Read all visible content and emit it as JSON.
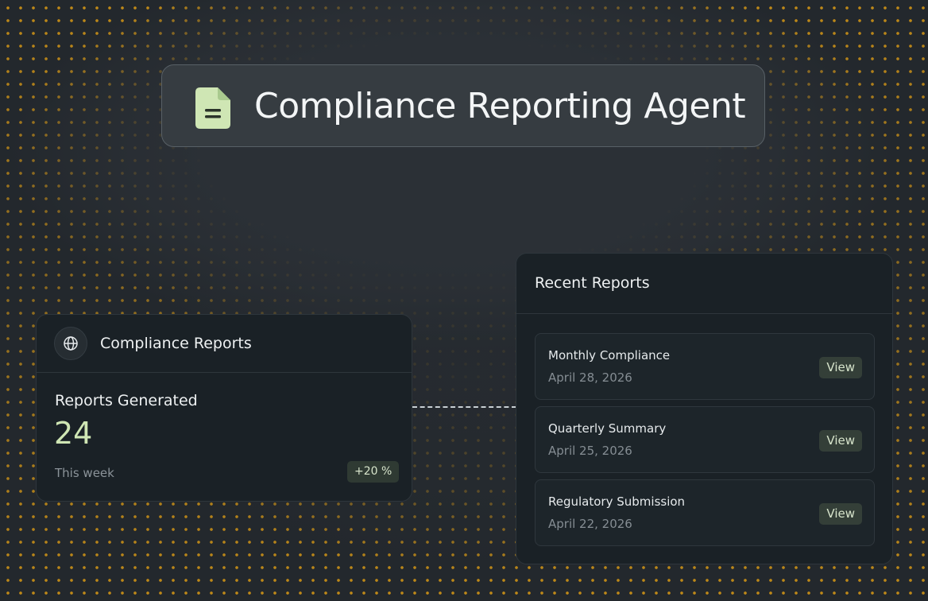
{
  "header": {
    "title": "Compliance Reporting Agent",
    "icon": "document-icon",
    "icon_color": "#cfe6b4"
  },
  "stats_card": {
    "title": "Compliance Reports",
    "icon": "globe-icon",
    "metric_label": "Reports Generated",
    "metric_value": "24",
    "period": "This week",
    "delta": "+20 %",
    "accent_color": "#cfe6b4"
  },
  "recent_reports": {
    "title": "Recent Reports",
    "items": [
      {
        "name": "Monthly Compliance",
        "date": "April 28, 2026",
        "action": "View"
      },
      {
        "name": "Quarterly Summary",
        "date": "April 25, 2026",
        "action": "View"
      },
      {
        "name": "Regulatory Submission",
        "date": "April 22, 2026",
        "action": "View"
      }
    ]
  },
  "colors": {
    "background": "#23282d",
    "dots": "#c08a18",
    "card": "#1a2126"
  }
}
